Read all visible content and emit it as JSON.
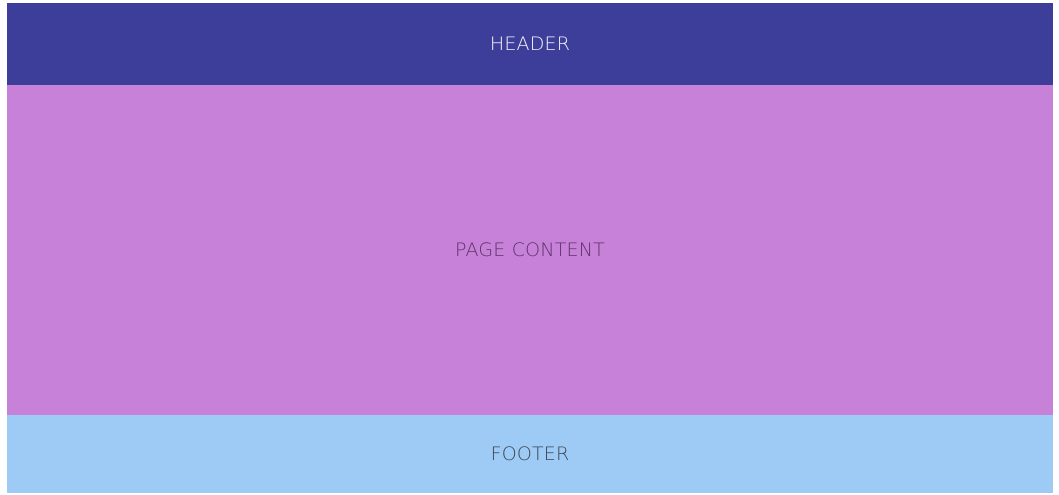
{
  "header": {
    "label": "HEADER",
    "background": "#3d3e9a"
  },
  "content": {
    "label": "PAGE CONTENT",
    "background": "#c881d9"
  },
  "footer": {
    "label": "FOOTER",
    "background": "#9ecbf6"
  }
}
